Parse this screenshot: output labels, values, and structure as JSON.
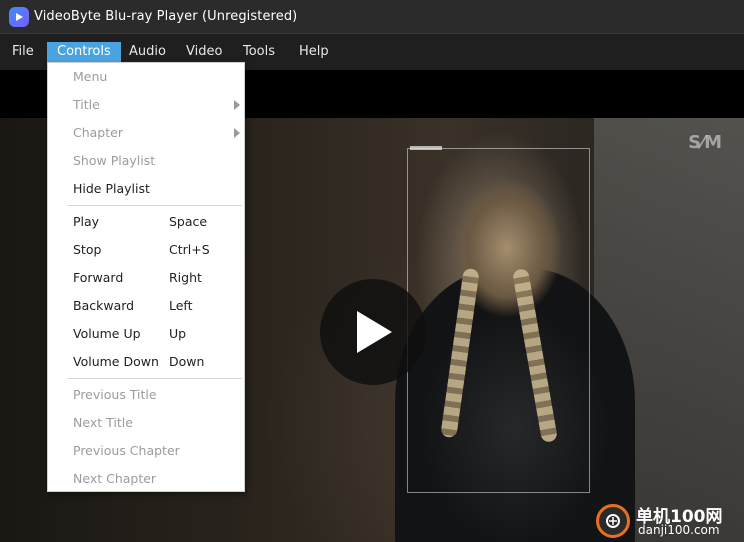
{
  "window": {
    "title": "VideoByte Blu-ray Player (Unregistered)"
  },
  "menubar": {
    "items": [
      {
        "id": "file",
        "label": "File"
      },
      {
        "id": "controls",
        "label": "Controls"
      },
      {
        "id": "audio",
        "label": "Audio"
      },
      {
        "id": "video",
        "label": "Video"
      },
      {
        "id": "tools",
        "label": "Tools"
      },
      {
        "id": "help",
        "label": "Help"
      }
    ],
    "active": "controls"
  },
  "controls_menu": {
    "group1": [
      {
        "label": "Menu",
        "enabled": false,
        "submenu": false
      },
      {
        "label": "Title",
        "enabled": false,
        "submenu": true
      },
      {
        "label": "Chapter",
        "enabled": false,
        "submenu": true
      },
      {
        "label": "Show Playlist",
        "enabled": false,
        "submenu": false
      },
      {
        "label": "Hide Playlist",
        "enabled": true,
        "submenu": false
      }
    ],
    "group2": [
      {
        "label": "Play",
        "shortcut": "Space"
      },
      {
        "label": "Stop",
        "shortcut": "Ctrl+S"
      },
      {
        "label": "Forward",
        "shortcut": "Right"
      },
      {
        "label": "Backward",
        "shortcut": "Left"
      },
      {
        "label": "Volume Up",
        "shortcut": "Up"
      },
      {
        "label": "Volume Down",
        "shortcut": "Down"
      }
    ],
    "group3": [
      {
        "label": "Previous Title",
        "enabled": false
      },
      {
        "label": "Next Title",
        "enabled": false
      },
      {
        "label": "Previous Chapter",
        "enabled": false
      },
      {
        "label": "Next Chapter",
        "enabled": false
      }
    ]
  },
  "video": {
    "corner_logo": "S⁄M",
    "play_icon": "play-icon"
  },
  "watermark": {
    "top": "单机100网",
    "bottom": "danji100.com"
  },
  "colors": {
    "menu_active": "#4aa3df",
    "titlebar": "#2b2b2b",
    "menubar": "#1f1f1f",
    "watermark_ring": "#e8701f"
  }
}
